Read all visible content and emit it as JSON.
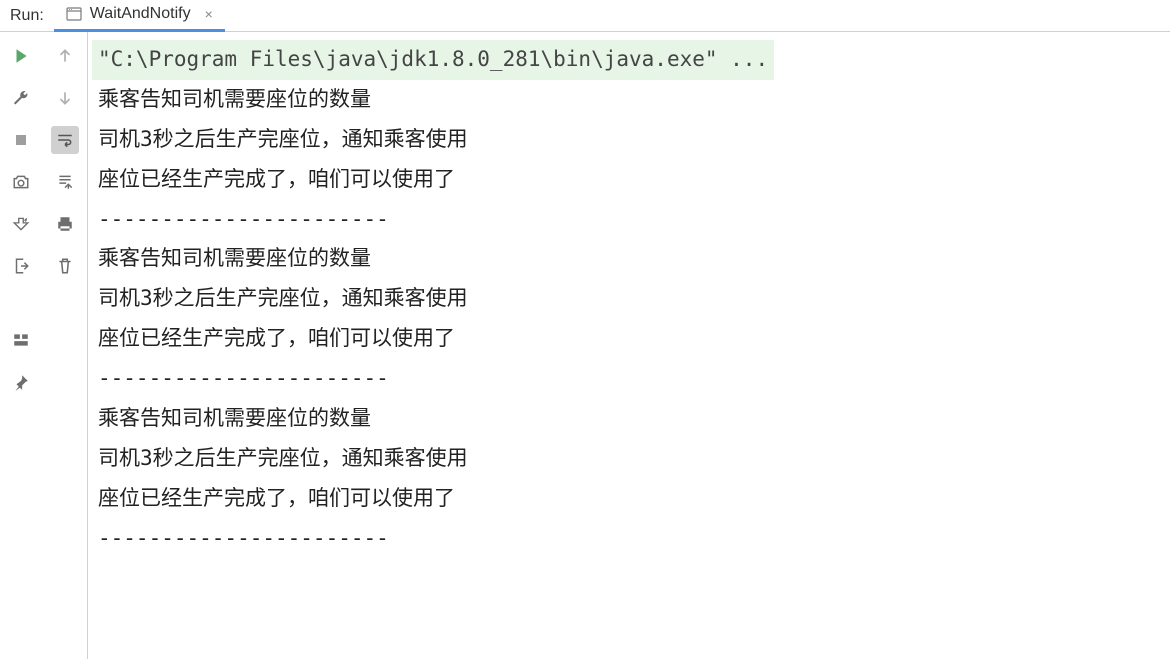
{
  "header": {
    "run_label": "Run:",
    "tab_name": "WaitAndNotify",
    "tab_close": "×"
  },
  "console": {
    "command": "\"C:\\Program Files\\java\\jdk1.8.0_281\\bin\\java.exe\" ...",
    "lines": [
      "乘客告知司机需要座位的数量",
      "司机3秒之后生产完座位，通知乘客使用",
      "座位已经生产完成了，咱们可以使用了",
      "-----------------------",
      "乘客告知司机需要座位的数量",
      "司机3秒之后生产完座位，通知乘客使用",
      "座位已经生产完成了，咱们可以使用了",
      "-----------------------",
      "乘客告知司机需要座位的数量",
      "司机3秒之后生产完座位，通知乘客使用",
      "座位已经生产完成了，咱们可以使用了",
      "-----------------------"
    ]
  }
}
